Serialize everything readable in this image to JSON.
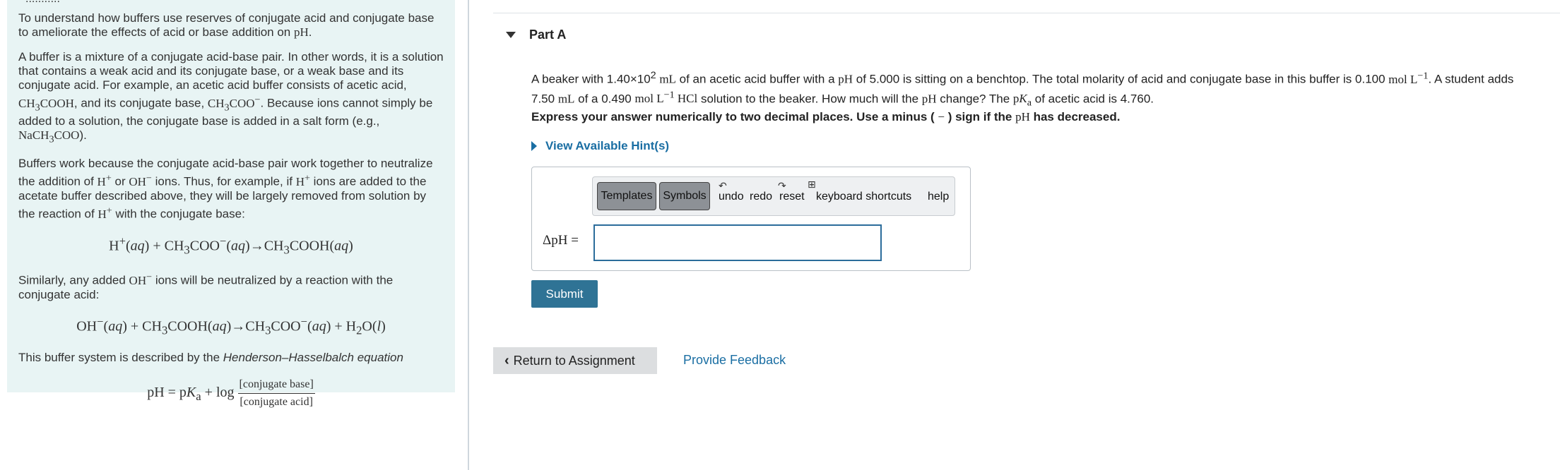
{
  "intro": {
    "heading_partial": "...........",
    "p1": "To understand how buffers use reserves of conjugate acid and conjugate base to ameliorate the effects of acid or base addition on pH.",
    "p2": "A buffer is a mixture of a conjugate acid-base pair. In other words, it is a solution that contains a weak acid and its conjugate base, or a weak base and its conjugate acid. For example, an acetic acid buffer consists of acetic acid, CH3COOH, and its conjugate base, CH3COO−. Because ions cannot simply be added to a solution, the conjugate base is added in a salt form (e.g., NaCH3COO).",
    "p3": "Buffers work because the conjugate acid-base pair work together to neutralize the addition of H+ or OH− ions. Thus, for example, if H+ ions are added to the acetate buffer described above, they will be largely removed from solution by the reaction of H+ with the conjugate base:",
    "eq1": "H+(aq) + CH3COO−(aq)→CH3COOH(aq)",
    "p4": "Similarly, any added OH− ions will be neutralized by a reaction with the conjugate acid:",
    "eq2": "OH−(aq) + CH3COOH(aq)→CH3COO−(aq) + H2O(l)",
    "p5": "This buffer system is described by the Henderson–Hasselbalch equation",
    "eq3": "pH = pKa + log [conjugate base] / [conjugate acid]",
    "eq3_num": "[conjugate base]",
    "eq3_den": "[conjugate acid]"
  },
  "part": {
    "title": "Part A"
  },
  "question": {
    "line1": "A beaker with 1.40×10² mL of an acetic acid buffer with a pH of 5.000 is sitting on a benchtop. The total molarity of acid and conjugate base in this buffer is 0.100 mol L⁻¹. A student adds",
    "line2": "7.50 mL of a 0.490 mol L⁻¹ HCl solution to the beaker. How much will the pH change? The pKa of acetic acid is 4.760.",
    "instruction": "Express your answer numerically to two decimal places. Use a minus ( − ) sign if the pH has decreased."
  },
  "hint": {
    "label": "View Available Hint(s)"
  },
  "toolbar": {
    "templates": "Templates",
    "symbols": "Symbols",
    "undo": "undo",
    "redo": "redo",
    "reset": "reset",
    "keyboard": "keyboard shortcuts",
    "help": "help"
  },
  "answer": {
    "label": "ΔpH =",
    "value": ""
  },
  "submit": {
    "label": "Submit"
  },
  "nav": {
    "return_label": "Return to Assignment",
    "feedback_label": "Provide Feedback"
  }
}
